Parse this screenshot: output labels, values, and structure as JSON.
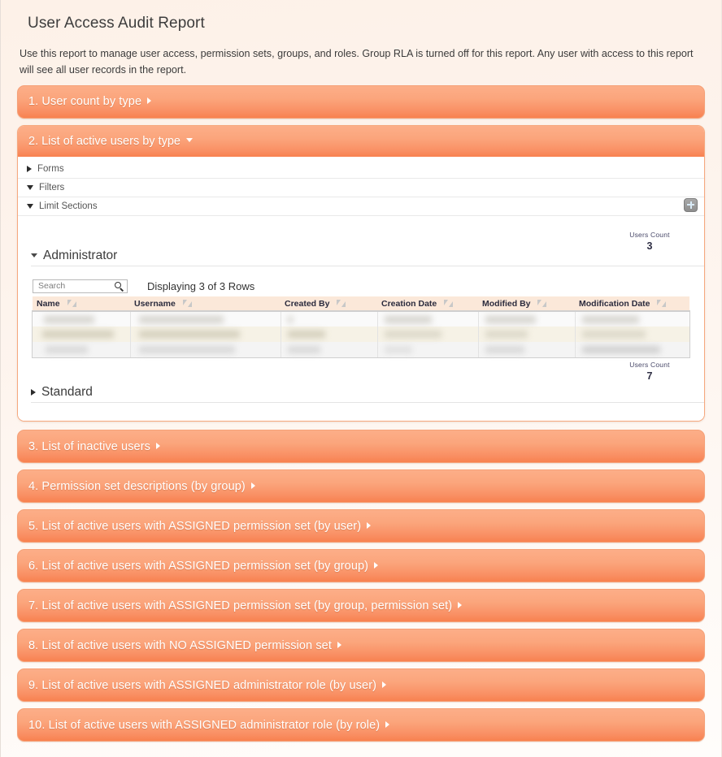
{
  "report": {
    "title": "User Access Audit Report",
    "description": "Use this report to manage user access, permission sets, groups, and roles. Group RLA is turned off for this report. Any user with access to this report will see all user records in the report."
  },
  "sections": [
    {
      "index": "1.",
      "label": "1. User count by type",
      "state": "collapsed"
    },
    {
      "index": "2.",
      "label": "2. List of active users by type",
      "state": "expanded"
    },
    {
      "index": "3.",
      "label": "3. List of inactive users",
      "state": "collapsed"
    },
    {
      "index": "4.",
      "label": "4. Permission set descriptions (by group)",
      "state": "collapsed"
    },
    {
      "index": "5.",
      "label": "5. List of active users with ASSIGNED permission set (by user)",
      "state": "collapsed"
    },
    {
      "index": "6.",
      "label": "6. List of active users with ASSIGNED permission set (by group)",
      "state": "collapsed"
    },
    {
      "index": "7.",
      "label": "7. List of active users with ASSIGNED permission set (by group, permission set)",
      "state": "collapsed"
    },
    {
      "index": "8.",
      "label": "8. List of active users with NO ASSIGNED permission set",
      "state": "collapsed"
    },
    {
      "index": "9.",
      "label": "9. List of active users with ASSIGNED administrator role (by user)",
      "state": "collapsed"
    },
    {
      "index": "10.",
      "label": "10. List of active users with ASSIGNED administrator role (by role)",
      "state": "collapsed"
    }
  ],
  "expanded_panel": {
    "header_label": "2. List of active users by type",
    "accordions": [
      {
        "label": "Forms",
        "state": "collapsed"
      },
      {
        "label": "Filters",
        "state": "expanded"
      },
      {
        "label": "Limit Sections",
        "state": "expanded"
      }
    ],
    "add_button_icon": "plus-icon",
    "groups": [
      {
        "name": "Administrator",
        "state": "expanded",
        "users_count_label": "Users Count",
        "users_count_value": "3",
        "search_placeholder": "Search",
        "search_value": "",
        "search_icon": "magnifier-icon",
        "displaying_text": "Displaying 3 of 3 Rows",
        "columns": [
          "Name",
          "Username",
          "Created By",
          "Creation Date",
          "Modified By",
          "Modification Date"
        ],
        "rows_redacted": 3
      },
      {
        "name": "Standard",
        "state": "collapsed",
        "users_count_label": "Users Count",
        "users_count_value": "7"
      }
    ]
  },
  "colors": {
    "section_bar_top": "#fcae88",
    "section_bar_bottom": "#f8814f",
    "panel_border": "#f6a87e",
    "page_background": "#fdf2ea",
    "table_header_background": "#fbe8d9"
  }
}
